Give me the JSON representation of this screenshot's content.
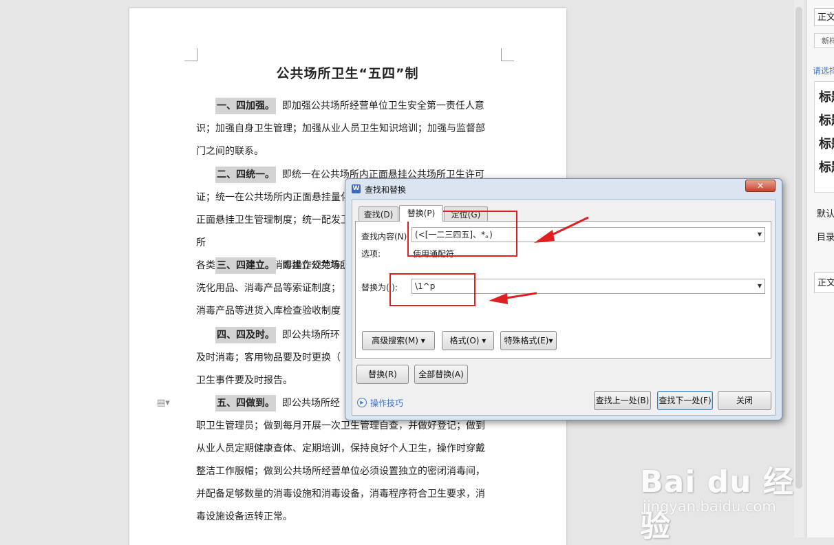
{
  "document": {
    "title": "公共场所卫生“五四”制",
    "paragraphs": [
      {
        "heading": "一、四加强。",
        "lines": [
          "即加强公共场所经营单位卫生安全第一责任人意",
          "识；加强自身卫生管理；加强从业人员卫生知识培训；加强与监督部",
          "门之间的联系。"
        ]
      },
      {
        "heading": "二、四统一。",
        "lines": [
          "即统一在公共场所内正面悬挂公共场所卫生许可",
          "证；统一在公共场所内正面悬挂量化分级标识牌；统一在公共场所内",
          "正面悬挂卫生管理制度；统一配发卫生知识宣传资料；统一规范公共场所",
          "各类公共用品清洗消毒操作规范等。"
        ]
      },
      {
        "heading": "三、四建立。",
        "lines": [
          "即建立公共场所",
          "洗化用品、消毒产品等索证制度；",
          "消毒产品等进货入库检查验收制度"
        ]
      },
      {
        "heading": "四、四及时。",
        "lines": [
          "即公共场所环",
          "及时消毒；客用物品要及时更换（",
          "卫生事件要及时报告。"
        ]
      },
      {
        "heading": "五、四做到。",
        "lines": [
          "即公共场所经",
          "职卫生管理员；做到每月开展一次卫生管理自查，并做好登记；做到",
          "从业人员定期健康查体、定期培训，保持良好个人卫生，操作时穿戴",
          "整洁工作服帽；做到公共场所经营单位必须设置独立的密闭消毒间，",
          "并配备足够数量的消毒设施和消毒设备，消毒程序符合卫生要求，消",
          "毒设施设备运转正常。"
        ]
      }
    ]
  },
  "side_panel": {
    "style_box": "正文",
    "new_style_btn": "新样式",
    "select_link": "请选择",
    "headings": [
      "标题",
      "标题",
      "标题",
      "标题"
    ],
    "default_label": "默认",
    "toc_label": "目录",
    "bottom_style": "正文"
  },
  "dialog": {
    "app_icon": "W",
    "title": "查找和替换",
    "close_label": "✕",
    "tabs": [
      "查找(D)",
      "替换(P)",
      "定位(G)"
    ],
    "find_label": "查找内容(N):",
    "find_value": "(<[一二三四五]、*。)",
    "options_label": "选项:",
    "options_value": "使用通配符",
    "replace_label": "替换为(I):",
    "replace_value": "\\1^p",
    "buttons": {
      "advanced": "高级搜索(M)",
      "format": "格式(O)",
      "special": "特殊格式(E)",
      "replace": "替换(R)",
      "replace_all": "全部替换(A)",
      "find_prev": "查找上一处(B)",
      "find_next": "查找下一处(F)",
      "close": "关闭"
    },
    "help_link": "操作技巧"
  },
  "watermark": {
    "brand": "Bai du 经验",
    "url": "jingyan.baidu.com"
  },
  "colors": {
    "annotation": "#e02020",
    "dialog_frame": "#dbe5f1",
    "highlight": "#d3d3d3"
  }
}
